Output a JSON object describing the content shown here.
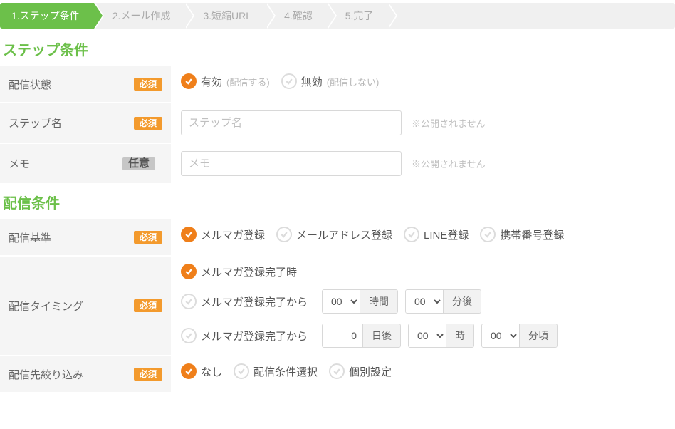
{
  "stepper": {
    "steps": [
      {
        "label": "1.ステップ条件",
        "active": true
      },
      {
        "label": "2.メール作成",
        "active": false
      },
      {
        "label": "3.短縮URL",
        "active": false
      },
      {
        "label": "4.確認",
        "active": false
      },
      {
        "label": "5.完了",
        "active": false
      }
    ]
  },
  "badges": {
    "required": "必須",
    "optional": "任意"
  },
  "section1": {
    "title": "ステップ条件",
    "status": {
      "label": "配信状態",
      "on": {
        "label": "有効",
        "sub": "(配信する)"
      },
      "off": {
        "label": "無効",
        "sub": "(配信しない)"
      }
    },
    "name": {
      "label": "ステップ名",
      "placeholder": "ステップ名",
      "value": "",
      "hint": "※公開されません"
    },
    "memo": {
      "label": "メモ",
      "placeholder": "メモ",
      "value": "",
      "hint": "※公開されません"
    }
  },
  "section2": {
    "title": "配信条件",
    "basis": {
      "label": "配信基準",
      "options": [
        {
          "label": "メルマガ登録",
          "selected": true
        },
        {
          "label": "メールアドレス登録",
          "selected": false
        },
        {
          "label": "LINE登録",
          "selected": false
        },
        {
          "label": "携帯番号登録",
          "selected": false
        }
      ]
    },
    "timing": {
      "label": "配信タイミング",
      "line1": {
        "label": "メルマガ登録完了時",
        "selected": true
      },
      "line2": {
        "label": "メルマガ登録完了から",
        "hours": {
          "value": "00",
          "unit": "時間"
        },
        "minutes": {
          "value": "00",
          "unit": "分後"
        }
      },
      "line3": {
        "label": "メルマガ登録完了から",
        "days": {
          "value": "0",
          "unit": "日後"
        },
        "hour": {
          "value": "00",
          "unit": "時"
        },
        "minute": {
          "value": "00",
          "unit": "分頃"
        }
      }
    },
    "filter": {
      "label": "配信先絞り込み",
      "options": [
        {
          "label": "なし",
          "selected": true
        },
        {
          "label": "配信条件選択",
          "selected": false
        },
        {
          "label": "個別設定",
          "selected": false
        }
      ]
    }
  }
}
